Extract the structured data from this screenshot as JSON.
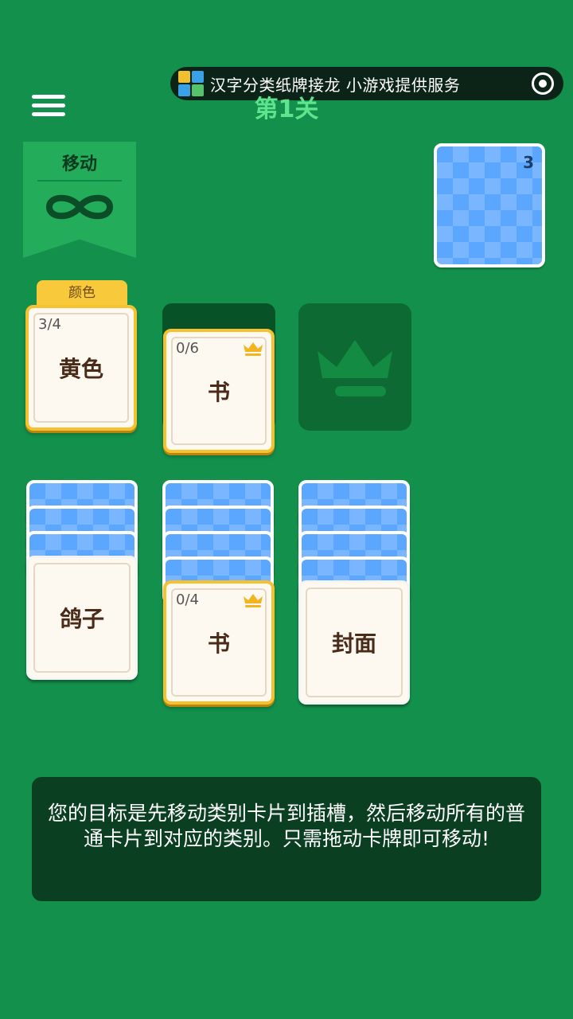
{
  "header": {
    "mini_program_title": "汉字分类纸牌接龙 小游戏提供服务",
    "level_title": "第1关"
  },
  "moves": {
    "label": "移动",
    "value": "∞"
  },
  "deck": {
    "remaining": "3"
  },
  "foundation": [
    {
      "category_tab": "颜色",
      "count": "3/4",
      "word": "黄色"
    },
    {
      "count": "0/6",
      "word": "书"
    }
  ],
  "tableau": [
    {
      "hidden_cards": 3,
      "top_word": "鸽子"
    },
    {
      "hidden_cards": 4,
      "top_count": "0/4",
      "top_word": "书"
    },
    {
      "hidden_cards": 4,
      "top_word": "封面"
    }
  ],
  "hint": {
    "text": "您的目标是先移动类别卡片到插槽，然后移动所有的普通卡片到对应的类别。只需拖动卡牌即可移动!"
  },
  "colors": {
    "background": "#13914c",
    "card_back": "#5ba6ff",
    "gold_border": "#f6c12e",
    "card_text": "#4a2a18"
  }
}
